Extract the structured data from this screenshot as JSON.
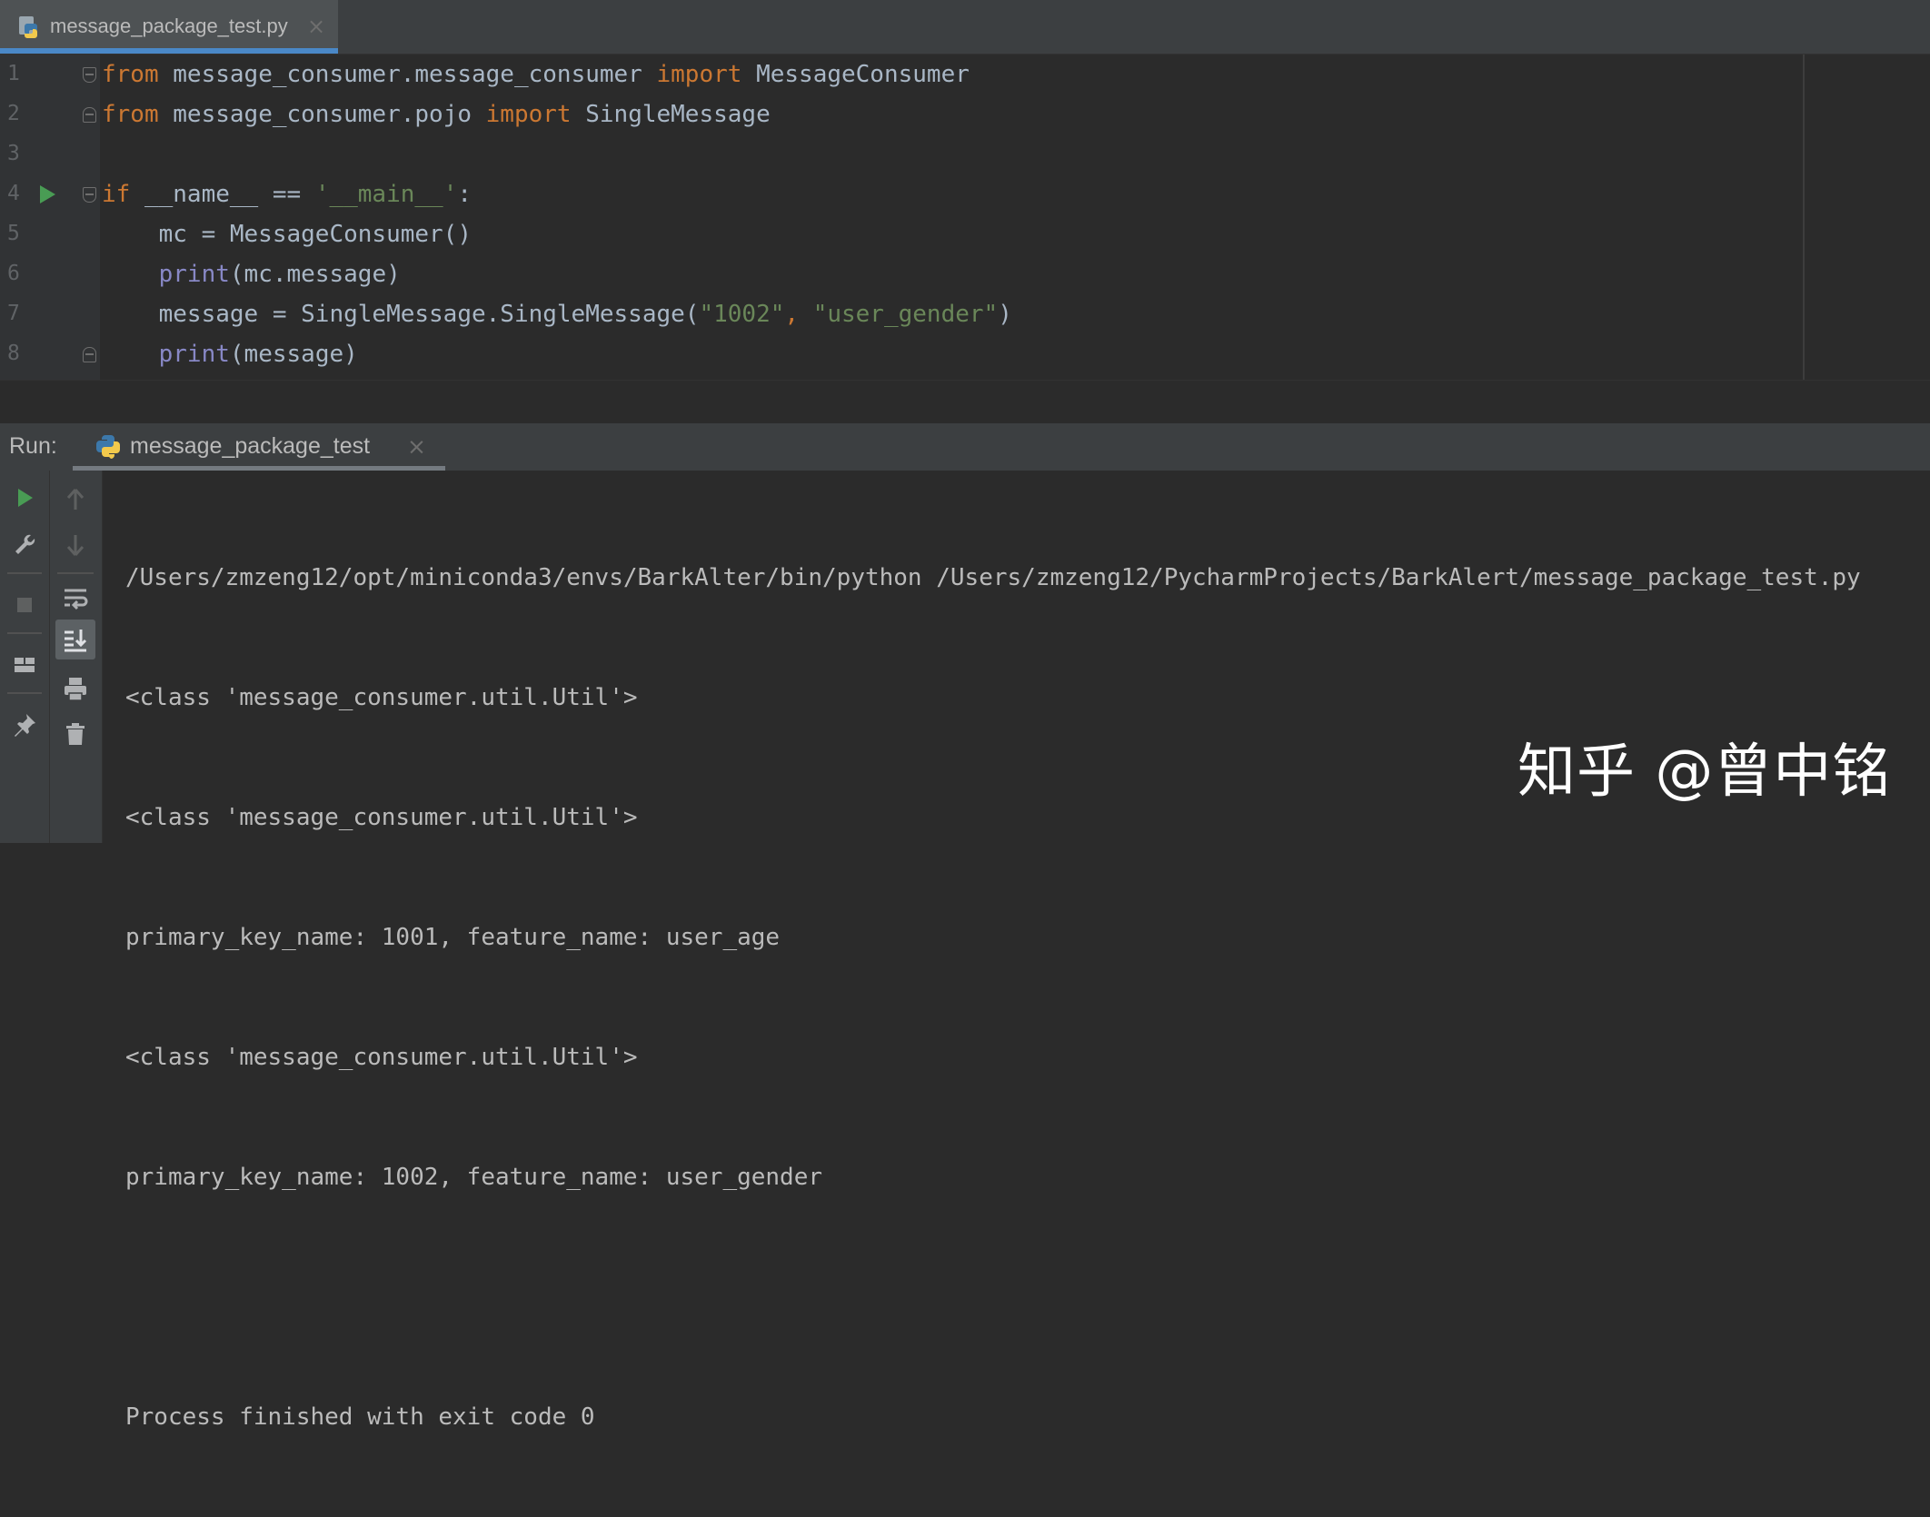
{
  "editor_tab": {
    "filename": "message_package_test.py",
    "close_glyph": "×"
  },
  "editor": {
    "lines": [
      {
        "num": "1",
        "segments": [
          {
            "text": "from",
            "cls": "kw"
          },
          {
            "text": " message_consumer.message_consumer ",
            "cls": ""
          },
          {
            "text": "import",
            "cls": "kw"
          },
          {
            "text": " MessageConsumer",
            "cls": ""
          }
        ]
      },
      {
        "num": "2",
        "segments": [
          {
            "text": "from",
            "cls": "kw"
          },
          {
            "text": " message_consumer.pojo ",
            "cls": ""
          },
          {
            "text": "import",
            "cls": "kw"
          },
          {
            "text": " SingleMessage",
            "cls": ""
          }
        ]
      },
      {
        "num": "3",
        "segments": []
      },
      {
        "num": "4",
        "segments": [
          {
            "text": "if",
            "cls": "kw"
          },
          {
            "text": " __name__ == ",
            "cls": ""
          },
          {
            "text": "'__main__'",
            "cls": "str"
          },
          {
            "text": ":",
            "cls": ""
          }
        ]
      },
      {
        "num": "5",
        "segments": [
          {
            "text": "    mc = MessageConsumer()",
            "cls": ""
          }
        ]
      },
      {
        "num": "6",
        "segments": [
          {
            "text": "    ",
            "cls": ""
          },
          {
            "text": "print",
            "cls": "bi"
          },
          {
            "text": "(mc.message)",
            "cls": ""
          }
        ]
      },
      {
        "num": "7",
        "segments": [
          {
            "text": "    message = SingleMessage.SingleMessage(",
            "cls": ""
          },
          {
            "text": "\"1002\"",
            "cls": "str"
          },
          {
            "text": ", ",
            "cls": "kw"
          },
          {
            "text": "\"user_gender\"",
            "cls": "str"
          },
          {
            "text": ")",
            "cls": ""
          }
        ]
      },
      {
        "num": "8",
        "segments": [
          {
            "text": "    ",
            "cls": ""
          },
          {
            "text": "print",
            "cls": "bi"
          },
          {
            "text": "(message)",
            "cls": ""
          }
        ]
      }
    ]
  },
  "run_panel": {
    "title": "Run:",
    "tab_label": "message_package_test",
    "close_glyph": "×",
    "output": [
      "/Users/zmzeng12/opt/miniconda3/envs/BarkAlter/bin/python /Users/zmzeng12/PycharmProjects/BarkAlert/message_package_test.py",
      "<class 'message_consumer.util.Util'>",
      "<class 'message_consumer.util.Util'>",
      "primary_key_name: 1001, feature_name: user_age",
      "<class 'message_consumer.util.Util'>",
      "primary_key_name: 1002, feature_name: user_gender",
      "",
      "Process finished with exit code 0"
    ]
  },
  "watermark": "知乎 @曾中铭",
  "colors": {
    "keyword": "#cc7832",
    "string": "#6a8759",
    "builtin": "#8888c6",
    "default": "#a9b7c6",
    "run_green": "#499c54",
    "tab_accent": "#4a88c7"
  },
  "icons": {
    "file_icon": "python-file-icon",
    "gutter_run": "run-gutter-icon",
    "toolbar_left": [
      "rerun-icon",
      "wrench-icon",
      "stop-icon",
      "layout-icon",
      "pin-icon"
    ],
    "toolbar_right": [
      "arrow-up-icon",
      "arrow-down-icon",
      "soft-wrap-icon",
      "scroll-to-end-icon",
      "print-icon",
      "trash-icon"
    ]
  }
}
